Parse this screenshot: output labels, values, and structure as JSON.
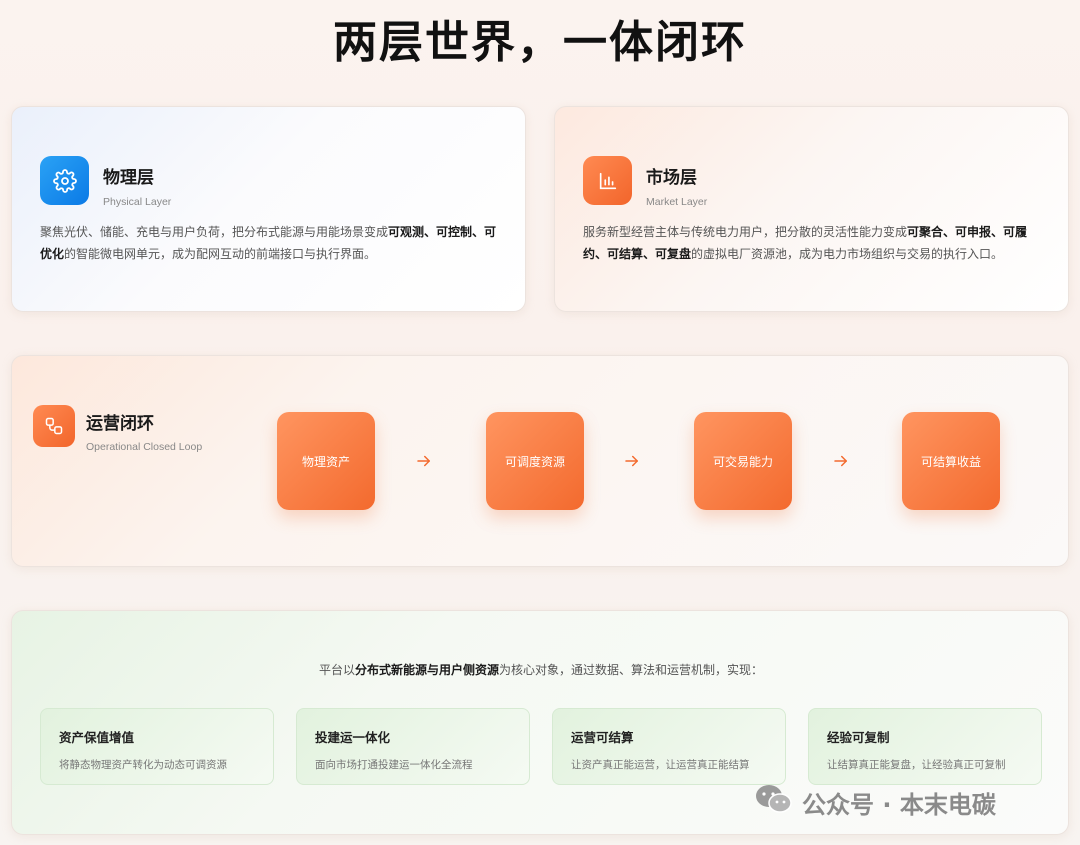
{
  "title": "两层世界，一体闭环",
  "physical": {
    "icon": "gear-icon",
    "title": "物理层",
    "subtitle": "Physical Layer",
    "desc_prefix": "聚焦光伏、储能、充电与用户负荷，把分布式能源与用能场景变成",
    "desc_bold": "可观测、可控制、可优化",
    "desc_suffix": "的智能微电网单元，成为配网互动的前端接口与执行界面。"
  },
  "market": {
    "icon": "bar-chart-icon",
    "title": "市场层",
    "subtitle": "Market Layer",
    "desc_prefix": "服务新型经营主体与传统电力用户，把分散的灵活性能力变成",
    "desc_bold": "可聚合、可申报、可履约、可结算、可复盘",
    "desc_suffix": "的虚拟电厂资源池，成为电力市场组织与交易的执行入口。"
  },
  "loop": {
    "icon": "link-nodes-icon",
    "title": "运营闭环",
    "subtitle": "Operational Closed Loop",
    "steps": [
      "物理资产",
      "可调度资源",
      "可交易能力",
      "可结算收益"
    ]
  },
  "platform": {
    "intro_prefix": "平台以",
    "intro_bold": "分布式新能源与用户侧资源",
    "intro_suffix": "为核心对象，通过数据、算法和运营机制，实现：",
    "features": [
      {
        "title": "资产保值增值",
        "desc": "将静态物理资产转化为动态可调资源"
      },
      {
        "title": "投建运一体化",
        "desc": "面向市场打通投建运一体化全流程"
      },
      {
        "title": "运营可结算",
        "desc": "让资产真正能运营，让运营真正能结算"
      },
      {
        "title": "经验可复制",
        "desc": "让结算真正能复盘，让经验真正可复制"
      }
    ]
  },
  "watermark": {
    "icon": "wechat-icon",
    "text": "公众号 · 本末电碳"
  },
  "colors": {
    "accent_orange": "#f36a2e",
    "accent_blue": "#0b7ae6",
    "accent_green": "#d6ead2"
  }
}
